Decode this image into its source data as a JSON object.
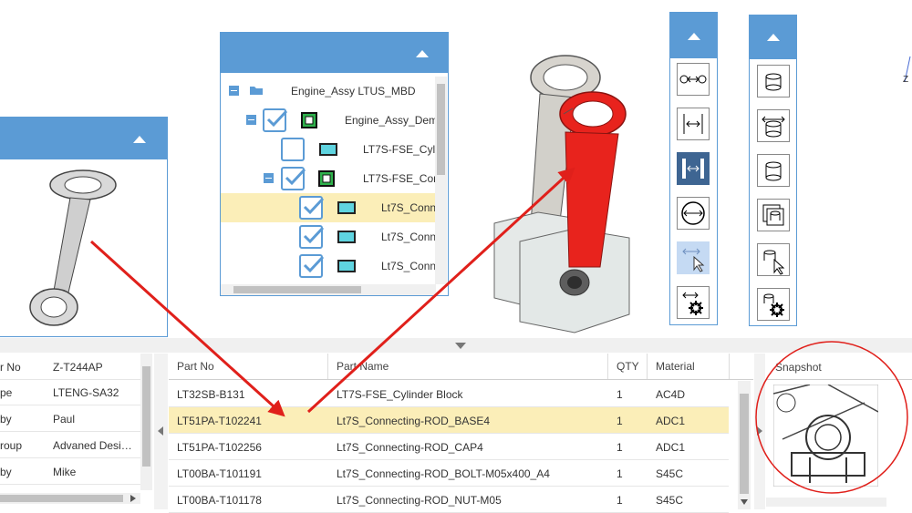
{
  "tree": {
    "items": [
      {
        "label": "Engine_Assy LTUS_MBD"
      },
      {
        "label": "Engine_Assy_Dem"
      },
      {
        "label": "LT7S-FSE_Cyli"
      },
      {
        "label": "LT7S-FSE_Con"
      },
      {
        "label": "Lt7S_Conn"
      },
      {
        "label": "Lt7S_Conn"
      },
      {
        "label": "Lt7S_Conn"
      }
    ]
  },
  "properties": {
    "rows": [
      {
        "label": "r No",
        "value": "Z-T244AP"
      },
      {
        "label": "pe",
        "value": "LTENG-SA32"
      },
      {
        "label": "by",
        "value": "Paul"
      },
      {
        "label": "roup",
        "value": "Advaned Desi…"
      },
      {
        "label": "by",
        "value": "Mike"
      }
    ]
  },
  "table": {
    "columns": [
      "Part No",
      "Part Name",
      "QTY",
      "Material"
    ],
    "rows": [
      {
        "part_no": "LT32SB-B131",
        "part_name": "LT7S-FSE_Cylinder Block",
        "qty": "1",
        "material": "AC4D"
      },
      {
        "part_no": "LT51PA-T102241",
        "part_name": "Lt7S_Connecting-ROD_BASE4",
        "qty": "1",
        "material": "ADC1"
      },
      {
        "part_no": "LT51PA-T102256",
        "part_name": "Lt7S_Connecting-ROD_CAP4",
        "qty": "1",
        "material": "ADC1"
      },
      {
        "part_no": "LT00BA-T101191",
        "part_name": "Lt7S_Connecting-ROD_BOLT-M05x400_A4",
        "qty": "1",
        "material": "S45C"
      },
      {
        "part_no": "LT00BA-T101178",
        "part_name": "Lt7S_Connecting-ROD_NUT-M05",
        "qty": "1",
        "material": "S45C"
      }
    ]
  },
  "snapshot": {
    "title": "Snapshot"
  },
  "axis": {
    "label": "Z"
  },
  "colors": {
    "panel": "#5b9bd5",
    "selected_row": "#fbeeb8",
    "highlight_part": "#e8231d",
    "annotation": "#e0201b"
  },
  "icons": {
    "measure_toolbar": [
      "point-to-point-icon",
      "edge-distance-icon",
      "face-distance-icon",
      "diameter-icon",
      "pointer-distance-icon",
      "measure-settings-icon"
    ],
    "view_toolbar": [
      "box-view-icon",
      "section-view-icon",
      "cylinder-view-icon",
      "stacked-view-icon",
      "select-view-icon",
      "view-settings-icon"
    ]
  }
}
